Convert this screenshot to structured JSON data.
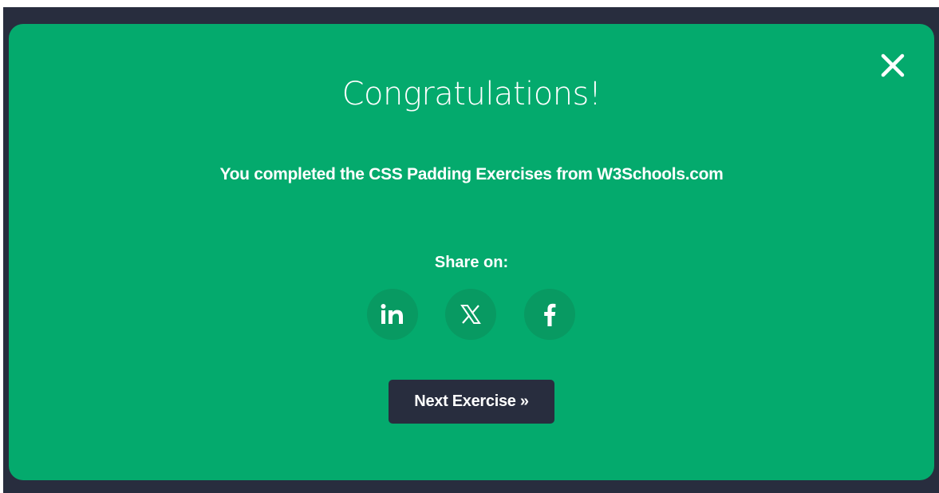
{
  "modal": {
    "title": "Congratulations!",
    "message": "You completed the CSS Padding Exercises from W3Schools.com",
    "share_label": "Share on:",
    "close_icon": "close-icon",
    "share_buttons": [
      {
        "icon": "linkedin-icon",
        "glyph": "in"
      },
      {
        "icon": "x-twitter-icon",
        "glyph": "𝕏"
      },
      {
        "icon": "facebook-icon",
        "glyph": "f"
      }
    ],
    "next_button_label": "Next Exercise »"
  },
  "colors": {
    "backdrop": "#282d3e",
    "modal_background": "#04aa6d",
    "social_circle": "#089a62",
    "button_background": "#282d3e",
    "text": "#ffffff"
  }
}
